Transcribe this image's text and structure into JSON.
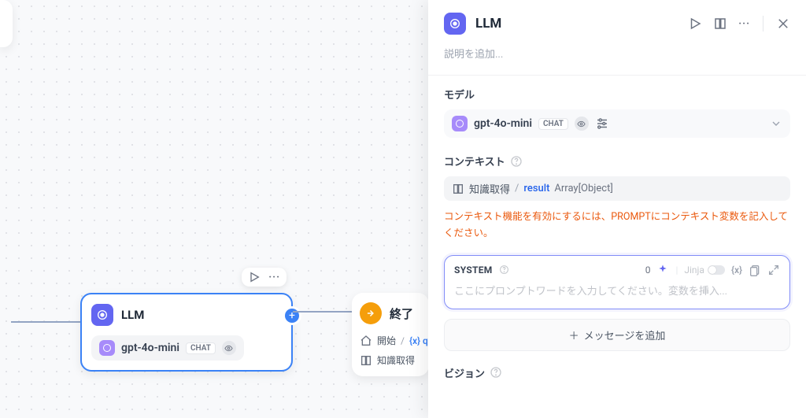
{
  "canvas": {
    "llmNode": {
      "title": "LLM",
      "modelName": "gpt-4o-mini",
      "modelBadge": "CHAT"
    },
    "endNode": {
      "title": "終了",
      "row1_label": "開始",
      "row1_var": "{x} q",
      "row2_label": "知識取得"
    }
  },
  "panel": {
    "title": "LLM",
    "descPlaceholder": "説明を追加...",
    "modelSection": "モデル",
    "modelName": "gpt-4o-mini",
    "modelBadge": "CHAT",
    "contextSection": "コンテキスト",
    "contextChip": {
      "knowledge": "知識取得",
      "slash": "/",
      "result": "result",
      "array": "Array[Object]"
    },
    "contextWarning": "コンテキスト機能を有効にするには、PROMPTにコンテキスト変数を記入してください。",
    "prompt": {
      "system": "SYSTEM",
      "count": "0",
      "jinja": "Jinja",
      "varBtn": "{x}",
      "placeholder": "ここにプロンプトワードを入力してください。変数を挿入..."
    },
    "addMessage": "メッセージを追加",
    "visionSection": "ビジョン"
  }
}
